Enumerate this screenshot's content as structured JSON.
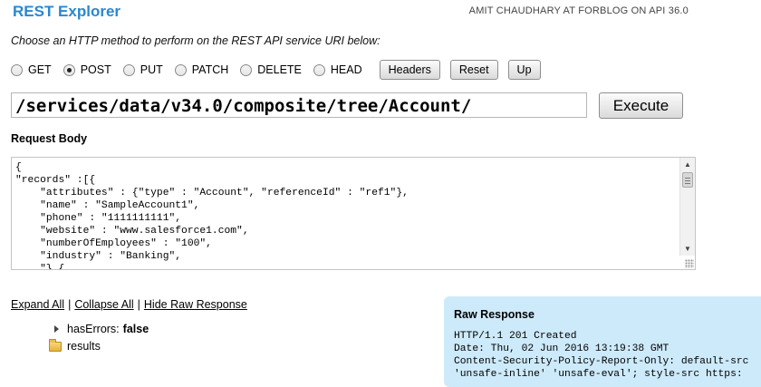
{
  "header": {
    "title": "REST Explorer",
    "user_info": "AMIT CHAUDHARY AT FORBLOG ON API 36.0"
  },
  "instructions": "Choose an HTTP method to perform on the REST API service URI below:",
  "methods": {
    "options": [
      "GET",
      "POST",
      "PUT",
      "PATCH",
      "DELETE",
      "HEAD"
    ],
    "selected": "POST"
  },
  "toolbar": {
    "headers_label": "Headers",
    "reset_label": "Reset",
    "up_label": "Up"
  },
  "url": {
    "value": "/services/data/v34.0/composite/tree/Account/"
  },
  "execute_label": "Execute",
  "request": {
    "label": "Request Body",
    "body": "{\n\"records\" :[{\n    \"attributes\" : {\"type\" : \"Account\", \"referenceId\" : \"ref1\"},\n    \"name\" : \"SampleAccount1\",\n    \"phone\" : \"1111111111\",\n    \"website\" : \"www.salesforce1.com\",\n    \"numberOfEmployees\" : \"100\",\n    \"industry\" : \"Banking\",\n    \"},{"
  },
  "links": {
    "expand_all": "Expand All",
    "collapse_all": "Collapse All",
    "hide_raw": "Hide Raw Response",
    "separator": "|"
  },
  "tree": {
    "has_errors_key": "hasErrors:",
    "has_errors_value": "false",
    "results_label": "results"
  },
  "raw_response": {
    "title": "Raw Response",
    "lines": "HTTP/1.1 201 Created\nDate: Thu, 02 Jun 2016 13:19:38 GMT\nContent-Security-Policy-Report-Only: default-src\n'unsafe-inline' 'unsafe-eval'; style-src https:"
  },
  "colors": {
    "title_blue": "#2a87cf",
    "raw_panel_bg": "#cdeafa"
  }
}
